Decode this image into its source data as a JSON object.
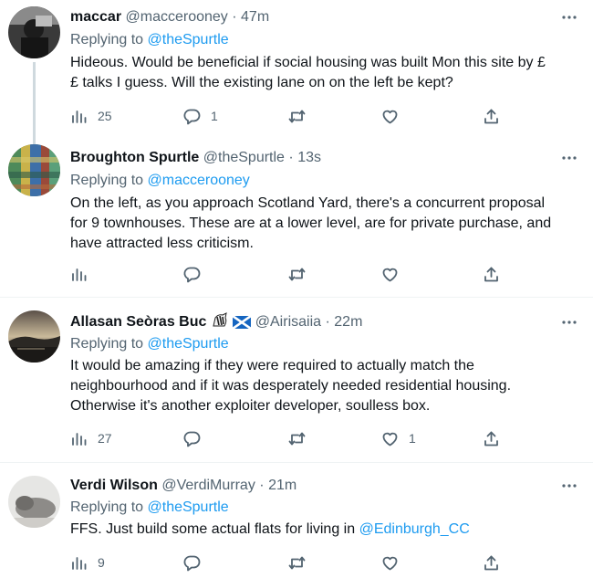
{
  "tweets": [
    {
      "name": "maccar",
      "handle": "@maccerooney",
      "time": "47m",
      "reply_prefix": "Replying to",
      "reply_to": "@theSpurtle",
      "text_lines": [
        "Hideous. Would be beneficial if social housing was built Mon this site by £",
        "£ talks I guess. Will the existing lane on on the left be kept?"
      ],
      "views": "25",
      "replies": "1",
      "retweets": "",
      "likes": ""
    },
    {
      "name": "Broughton Spurtle",
      "handle": "@theSpurtle",
      "time": "13s",
      "reply_prefix": "Replying to",
      "reply_to": "@maccerooney",
      "text_lines": [
        "On the left, as you approach Scotland Yard, there's a concurrent proposal",
        "for 9 townhouses. These are at a lower level, are for private purchase, and",
        "have attracted less criticism."
      ],
      "views": "",
      "replies": "",
      "retweets": "",
      "likes": ""
    },
    {
      "name": "Allasan Seòras Buc",
      "handle": "@Airisaiia",
      "time": "22m",
      "reply_prefix": "Replying to",
      "reply_to": "@theSpurtle",
      "text_lines": [
        "It would be amazing if they were required to actually match the",
        "neighbourhood and if it was desperately needed residential housing.",
        "Otherwise it's another exploiter developer, soulless box."
      ],
      "views": "27",
      "replies": "",
      "retweets": "",
      "likes": "1"
    },
    {
      "name": "Verdi Wilson",
      "handle": "@VerdiMurray",
      "time": "21m",
      "reply_prefix": "Replying to",
      "reply_to": "@theSpurtle",
      "text_before_link": "FFS. Just build some actual flats for living in ",
      "text_link": "@Edinburgh_CC",
      "views": "9",
      "replies": "",
      "retweets": "",
      "likes": ""
    }
  ],
  "separator": "·",
  "icons": {
    "more": "more-dots-icon",
    "views": "views-bar-chart-icon",
    "reply": "reply-bubble-icon",
    "retweet": "retweet-icon",
    "like": "heart-icon",
    "share": "share-upload-icon",
    "name_badges": [
      "zebra-emoji-icon",
      "scotland-flag-icon"
    ]
  },
  "colors": {
    "link": "#1d9bf0",
    "secondary_text": "#536471",
    "primary_text": "#0f1419",
    "divider": "#eff3f4",
    "thread_line": "#cfd9de"
  }
}
